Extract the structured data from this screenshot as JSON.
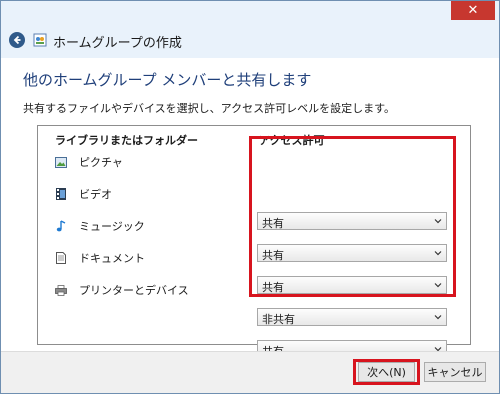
{
  "window": {
    "close_label": "✕",
    "title": "ホームグループの作成"
  },
  "main": {
    "heading": "他のホームグループ メンバーと共有します",
    "instruction": "共有するファイルやデバイスを選択し、アクセス許可レベルを設定します。",
    "columns": {
      "library": "ライブラリまたはフォルダー",
      "access": "アクセス許可"
    },
    "rows": [
      {
        "label": "ピクチャ",
        "icon": "pictures-icon",
        "value": "共有"
      },
      {
        "label": "ビデオ",
        "icon": "videos-icon",
        "value": "共有"
      },
      {
        "label": "ミュージック",
        "icon": "music-icon",
        "value": "共有"
      },
      {
        "label": "ドキュメント",
        "icon": "documents-icon",
        "value": "非共有"
      },
      {
        "label": "プリンターとデバイス",
        "icon": "printer-icon",
        "value": "共有"
      }
    ]
  },
  "footer": {
    "next_label": "次へ(N)",
    "cancel_label": "キャンセル"
  },
  "colors": {
    "highlight": "#d7141e",
    "heading": "#1f3f7a",
    "close_button": "#c7372f"
  }
}
